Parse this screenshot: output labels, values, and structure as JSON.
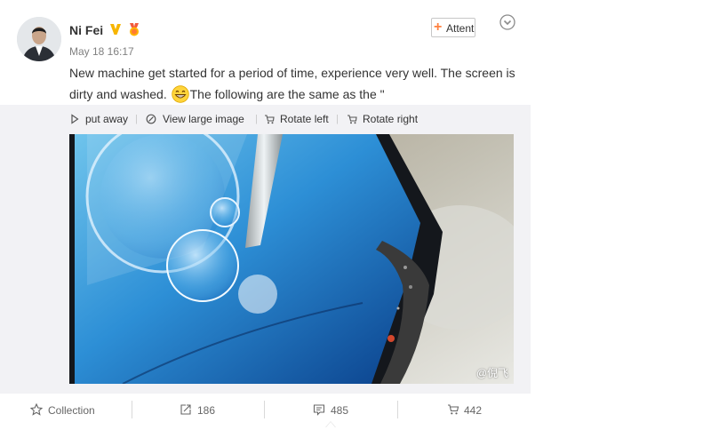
{
  "post": {
    "author": "Ni Fei",
    "time": "May 18 16:17",
    "follow_label": "Attenti",
    "text_part1": "New machine get started for a period of time, experience very well. The screen is dirty and washed.",
    "text_part2": "The following are the same as the \"",
    "emoji": "grin-emoji"
  },
  "media_tools": [
    {
      "label": "put away",
      "icon": "collapse-icon"
    },
    {
      "label": "View large image",
      "icon": "magnify-icon"
    },
    {
      "label": "Rotate left",
      "icon": "rotate-left-icon"
    },
    {
      "label": "Rotate right",
      "icon": "rotate-right-icon"
    }
  ],
  "watermark": "@倪飞",
  "actions": {
    "collection": "Collection",
    "repost": "186",
    "comments": "485",
    "likes": "442"
  },
  "colors": {
    "accent": "#ff8140",
    "verified": "#f7b500",
    "muted": "#808080"
  }
}
